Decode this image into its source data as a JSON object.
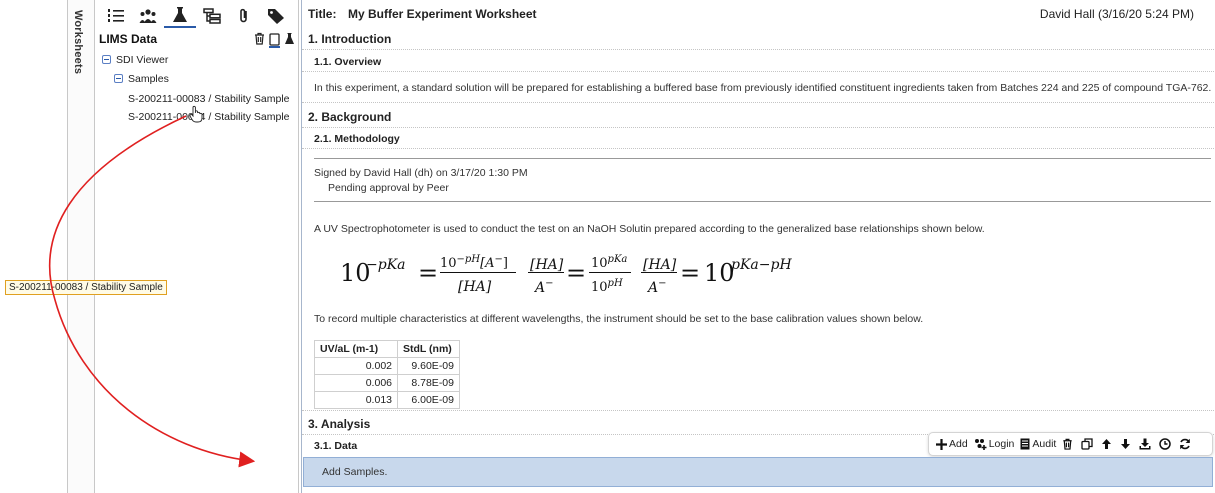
{
  "rail": {
    "label": "Worksheets"
  },
  "lims": {
    "title": "LIMS Data",
    "toolbar": [
      {
        "icon": "numbered-list-icon"
      },
      {
        "icon": "people-group-icon"
      },
      {
        "icon": "flask-icon",
        "active": true
      },
      {
        "icon": "hierarchy-icon"
      },
      {
        "icon": "paperclip-icon"
      },
      {
        "icon": "tag-icon"
      }
    ],
    "tree": {
      "root": "SDI Viewer",
      "group": "Samples",
      "items": [
        "S-200211-00083 / Stability Sample",
        "S-200211-00084 / Stability Sample"
      ]
    }
  },
  "drag": {
    "label": "S-200211-00083 / Stability Sample"
  },
  "doc": {
    "title_label": "Title:",
    "title": "My Buffer Experiment Worksheet",
    "author": "David Hall (3/16/20 5:24 PM)",
    "s1": "1.   Introduction",
    "s1_1": "1.1.   Overview",
    "overview_text": "In this experiment, a standard solution will be prepared for establishing a buffered base from previously identified constituent ingredients taken from Batches 224 and 225 of compound TGA-762.",
    "s2": "2.   Background",
    "s2_1": "2.1.   Methodology",
    "signed": "Signed by David Hall (dh) on 3/17/20 1:30 PM",
    "pending": "Pending approval by Peer",
    "uv_text": "A UV Spectrophotometer is used to conduct the test on an NaOH Solutin prepared according to the generalized base relationships shown below.",
    "record_text": "To record multiple characteristics at different wavelengths, the instrument should be set to the base calibration values shown below.",
    "table": {
      "headers": [
        "UV/aL (m-1)",
        "StdL (nm)"
      ],
      "rows": [
        [
          "0.002",
          "9.60E-09"
        ],
        [
          "0.006",
          "8.78E-09"
        ],
        [
          "0.013",
          "6.00E-09"
        ]
      ]
    },
    "s3": "3.   Analysis",
    "s3_1": "3.1.   Data",
    "toolbar": {
      "add": "Add",
      "login": "Login",
      "audit": "Audit"
    },
    "drop_text": "Add Samples."
  },
  "colors": {
    "arrow": "#e02020",
    "accent": "#2a5aa8",
    "drop_bg": "#c8d8ec"
  }
}
